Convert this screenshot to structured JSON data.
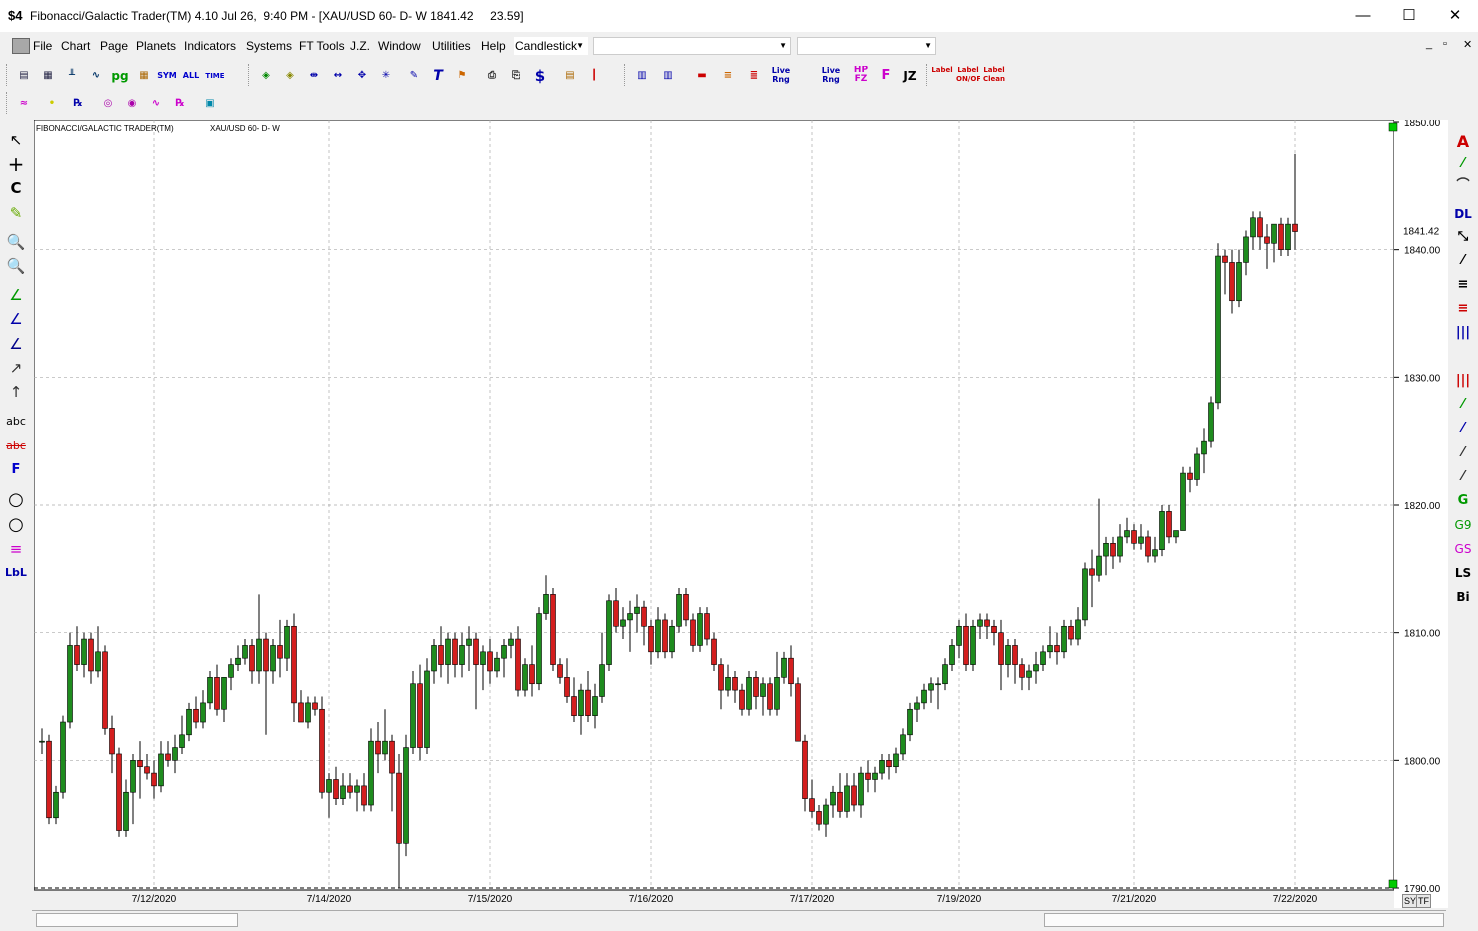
{
  "window": {
    "app_icon": "$4",
    "title": "Fibonacci/Galactic Trader(TM) 4.10 Jul 26,  9:40 PM - [XAU/USD 60- D- W 1841.42     23.59]",
    "minimize": "—",
    "maximize": "☐",
    "close": "✕"
  },
  "menu": {
    "items": [
      "File",
      "Chart",
      "Page",
      "Planets",
      "Indicators",
      "Systems",
      "FT Tools",
      "J.Z.",
      "Window",
      "Utilities",
      "Help"
    ],
    "chart_type": "Candlestick",
    "combo2": "",
    "combo3": "",
    "mdi_controls": [
      "_",
      "▫",
      "✕"
    ]
  },
  "toolbar1": [
    "pg",
    "SYM",
    "ALL",
    "TIME",
    "Live Rng",
    "Live Rng",
    "HP FZ",
    "JZ",
    "Label",
    "Label ON/OFF",
    "Label Clean"
  ],
  "left_tools": [
    "↖",
    "+",
    "C",
    "✎",
    "🔍",
    "🔍",
    "∠",
    "∠",
    "∠",
    "↗",
    "abc",
    "abc",
    "F",
    "○",
    "○",
    "≡",
    "LbL"
  ],
  "right_tools": [
    "A",
    "⁄",
    "⌒",
    "DL",
    "⤡",
    "⁄",
    "≡",
    "≡",
    "|||",
    "|||",
    "⁄",
    "⁄",
    "⁄",
    "⁄",
    "G",
    "G9",
    "GS",
    "LS",
    "Bi"
  ],
  "scroll": {
    "sy": "SY",
    "tf": "TF"
  },
  "chart_data": {
    "type": "candlestick",
    "title": "FIBONACCI/GALACTIC TRADER(TM)",
    "symbol": "XAU/USD 60- D- W",
    "last_price_label": "1841.42",
    "y_ticks": [
      "1850.00",
      "1840.00",
      "1830.00",
      "1820.00",
      "1810.00",
      "1800.00",
      "1790.00"
    ],
    "ylim": [
      1790,
      1850
    ],
    "x_ticks": [
      "7/12/2020",
      "7/14/2020",
      "7/15/2020",
      "7/16/2020",
      "7/17/2020",
      "7/19/2020",
      "7/21/2020",
      "7/22/2020"
    ],
    "x_tick_bar_index": [
      16,
      41,
      64,
      87,
      110,
      131,
      156,
      179
    ],
    "grid": true,
    "candles": [
      [
        1801.5,
        1802.5,
        1800.5,
        1801.5
      ],
      [
        1801.5,
        1802.0,
        1795.0,
        1795.5
      ],
      [
        1795.5,
        1798.0,
        1795.0,
        1797.5
      ],
      [
        1797.5,
        1803.5,
        1797.0,
        1803.0
      ],
      [
        1803.0,
        1810.0,
        1802.5,
        1809.0
      ],
      [
        1809.0,
        1810.5,
        1807.0,
        1807.5
      ],
      [
        1807.5,
        1810.0,
        1806.5,
        1809.5
      ],
      [
        1809.5,
        1810.0,
        1806.0,
        1807.0
      ],
      [
        1807.0,
        1810.5,
        1806.5,
        1808.5
      ],
      [
        1808.5,
        1809.0,
        1802.0,
        1802.5
      ],
      [
        1802.5,
        1803.5,
        1799.0,
        1800.5
      ],
      [
        1800.5,
        1801.0,
        1794.0,
        1794.5
      ],
      [
        1794.5,
        1798.5,
        1794.0,
        1797.5
      ],
      [
        1797.5,
        1800.5,
        1795.0,
        1800.0
      ],
      [
        1800.0,
        1801.5,
        1797.0,
        1799.5
      ],
      [
        1799.5,
        1800.5,
        1798.5,
        1799.0
      ],
      [
        1799.0,
        1800.0,
        1797.0,
        1798.0
      ],
      [
        1798.0,
        1801.5,
        1797.5,
        1800.5
      ],
      [
        1800.5,
        1801.5,
        1799.5,
        1800.0
      ],
      [
        1800.0,
        1802.0,
        1799.0,
        1801.0
      ],
      [
        1801.0,
        1803.5,
        1800.5,
        1802.0
      ],
      [
        1802.0,
        1804.5,
        1801.5,
        1804.0
      ],
      [
        1804.0,
        1805.0,
        1802.5,
        1803.0
      ],
      [
        1803.0,
        1805.5,
        1802.5,
        1804.5
      ],
      [
        1804.5,
        1807.0,
        1804.0,
        1806.5
      ],
      [
        1806.5,
        1807.5,
        1803.5,
        1804.0
      ],
      [
        1804.0,
        1806.5,
        1803.0,
        1806.5
      ],
      [
        1806.5,
        1808.0,
        1805.5,
        1807.5
      ],
      [
        1807.5,
        1809.0,
        1807.0,
        1808.0
      ],
      [
        1808.0,
        1809.5,
        1807.5,
        1809.0
      ],
      [
        1809.0,
        1809.5,
        1806.0,
        1807.0
      ],
      [
        1807.0,
        1813.0,
        1806.0,
        1809.5
      ],
      [
        1809.5,
        1810.0,
        1802.0,
        1807.0
      ],
      [
        1807.0,
        1809.5,
        1806.0,
        1809.0
      ],
      [
        1809.0,
        1811.0,
        1806.5,
        1808.0
      ],
      [
        1808.0,
        1811.0,
        1807.0,
        1810.5
      ],
      [
        1810.5,
        1811.5,
        1803.0,
        1804.5
      ],
      [
        1804.5,
        1805.5,
        1803.0,
        1803.0
      ],
      [
        1803.0,
        1805.0,
        1802.5,
        1804.5
      ],
      [
        1804.5,
        1805.0,
        1803.5,
        1804.0
      ],
      [
        1804.0,
        1805.0,
        1797.0,
        1797.5
      ],
      [
        1797.5,
        1799.0,
        1795.5,
        1798.5
      ],
      [
        1798.5,
        1799.5,
        1796.5,
        1797.0
      ],
      [
        1797.0,
        1799.0,
        1796.5,
        1798.0
      ],
      [
        1798.0,
        1799.0,
        1797.0,
        1797.5
      ],
      [
        1797.5,
        1798.5,
        1796.0,
        1798.0
      ],
      [
        1798.0,
        1799.0,
        1796.0,
        1796.5
      ],
      [
        1796.5,
        1802.5,
        1796.0,
        1801.5
      ],
      [
        1801.5,
        1803.0,
        1799.0,
        1800.5
      ],
      [
        1800.5,
        1804.0,
        1800.0,
        1801.5
      ],
      [
        1801.5,
        1802.0,
        1796.0,
        1799.0
      ],
      [
        1799.0,
        1800.5,
        1790.0,
        1793.5
      ],
      [
        1793.5,
        1802.0,
        1792.5,
        1801.0
      ],
      [
        1801.0,
        1807.0,
        1800.5,
        1806.0
      ],
      [
        1806.0,
        1807.5,
        1800.0,
        1801.0
      ],
      [
        1801.0,
        1808.0,
        1800.5,
        1807.0
      ],
      [
        1807.0,
        1809.5,
        1806.0,
        1809.0
      ],
      [
        1809.0,
        1810.5,
        1806.5,
        1807.5
      ],
      [
        1807.5,
        1810.0,
        1806.0,
        1809.5
      ],
      [
        1809.5,
        1810.0,
        1806.5,
        1807.5
      ],
      [
        1807.5,
        1810.0,
        1806.5,
        1809.0
      ],
      [
        1809.0,
        1810.5,
        1807.0,
        1809.5
      ],
      [
        1809.5,
        1810.0,
        1804.0,
        1807.5
      ],
      [
        1807.5,
        1809.0,
        1805.5,
        1808.5
      ],
      [
        1808.5,
        1809.5,
        1806.0,
        1807.0
      ],
      [
        1807.0,
        1808.5,
        1806.5,
        1808.0
      ],
      [
        1808.0,
        1809.5,
        1806.5,
        1809.0
      ],
      [
        1809.0,
        1810.0,
        1808.0,
        1809.5
      ],
      [
        1809.5,
        1810.5,
        1805.0,
        1805.5
      ],
      [
        1805.5,
        1808.0,
        1805.0,
        1807.5
      ],
      [
        1807.5,
        1809.0,
        1805.0,
        1806.0
      ],
      [
        1806.0,
        1812.0,
        1805.5,
        1811.5
      ],
      [
        1811.5,
        1814.5,
        1811.0,
        1813.0
      ],
      [
        1813.0,
        1813.5,
        1807.0,
        1807.5
      ],
      [
        1807.5,
        1808.0,
        1806.0,
        1806.5
      ],
      [
        1806.5,
        1808.0,
        1804.5,
        1805.0
      ],
      [
        1805.0,
        1806.5,
        1803.0,
        1803.5
      ],
      [
        1803.5,
        1806.0,
        1802.0,
        1805.5
      ],
      [
        1805.5,
        1807.0,
        1803.0,
        1803.5
      ],
      [
        1803.5,
        1806.0,
        1802.5,
        1805.0
      ],
      [
        1805.0,
        1810.0,
        1804.5,
        1807.5
      ],
      [
        1807.5,
        1813.0,
        1807.0,
        1812.5
      ],
      [
        1812.5,
        1813.5,
        1810.0,
        1810.5
      ],
      [
        1810.5,
        1812.0,
        1809.5,
        1811.0
      ],
      [
        1811.0,
        1812.5,
        1808.5,
        1811.5
      ],
      [
        1811.5,
        1813.0,
        1810.0,
        1812.0
      ],
      [
        1812.0,
        1812.5,
        1809.0,
        1810.5
      ],
      [
        1810.5,
        1811.0,
        1807.5,
        1808.5
      ],
      [
        1808.5,
        1812.0,
        1808.0,
        1811.0
      ],
      [
        1811.0,
        1811.5,
        1808.0,
        1808.5
      ],
      [
        1808.5,
        1811.0,
        1808.0,
        1810.5
      ],
      [
        1810.5,
        1813.5,
        1810.0,
        1813.0
      ],
      [
        1813.0,
        1813.5,
        1810.5,
        1811.0
      ],
      [
        1811.0,
        1811.5,
        1808.5,
        1809.0
      ],
      [
        1809.0,
        1812.0,
        1808.5,
        1811.5
      ],
      [
        1811.5,
        1812.0,
        1809.0,
        1809.5
      ],
      [
        1809.5,
        1810.0,
        1807.0,
        1807.5
      ],
      [
        1807.5,
        1808.0,
        1804.0,
        1805.5
      ],
      [
        1805.5,
        1807.5,
        1805.0,
        1806.5
      ],
      [
        1806.5,
        1807.0,
        1804.5,
        1805.5
      ],
      [
        1805.5,
        1806.0,
        1803.5,
        1804.0
      ],
      [
        1804.0,
        1807.0,
        1803.5,
        1806.5
      ],
      [
        1806.5,
        1807.0,
        1804.0,
        1805.0
      ],
      [
        1805.0,
        1806.5,
        1803.5,
        1806.0
      ],
      [
        1806.0,
        1806.5,
        1803.5,
        1804.0
      ],
      [
        1804.0,
        1808.5,
        1803.5,
        1806.5
      ],
      [
        1806.5,
        1808.5,
        1806.0,
        1808.0
      ],
      [
        1808.0,
        1809.0,
        1805.0,
        1806.0
      ],
      [
        1806.0,
        1806.5,
        1801.5,
        1801.5
      ],
      [
        1801.5,
        1802.0,
        1796.0,
        1797.0
      ],
      [
        1797.0,
        1798.5,
        1795.5,
        1796.0
      ],
      [
        1796.0,
        1796.5,
        1794.5,
        1795.0
      ],
      [
        1795.0,
        1797.0,
        1794.0,
        1796.5
      ],
      [
        1796.5,
        1798.0,
        1795.5,
        1797.5
      ],
      [
        1797.5,
        1799.0,
        1795.5,
        1796.0
      ],
      [
        1796.0,
        1799.0,
        1795.5,
        1798.0
      ],
      [
        1798.0,
        1799.0,
        1796.0,
        1796.5
      ],
      [
        1796.5,
        1799.5,
        1795.5,
        1799.0
      ],
      [
        1799.0,
        1800.0,
        1797.5,
        1798.5
      ],
      [
        1798.5,
        1799.5,
        1797.5,
        1799.0
      ],
      [
        1799.0,
        1800.5,
        1798.5,
        1800.0
      ],
      [
        1800.0,
        1800.5,
        1798.5,
        1799.5
      ],
      [
        1799.5,
        1801.0,
        1799.0,
        1800.5
      ],
      [
        1800.5,
        1802.5,
        1800.0,
        1802.0
      ],
      [
        1802.0,
        1804.5,
        1801.5,
        1804.0
      ],
      [
        1804.0,
        1805.0,
        1803.0,
        1804.5
      ],
      [
        1804.5,
        1806.0,
        1804.0,
        1805.5
      ],
      [
        1805.5,
        1806.5,
        1804.5,
        1806.0
      ],
      [
        1806.0,
        1806.5,
        1804.0,
        1806.0
      ],
      [
        1806.0,
        1808.0,
        1805.5,
        1807.5
      ],
      [
        1807.5,
        1809.5,
        1807.0,
        1809.0
      ],
      [
        1809.0,
        1811.0,
        1808.0,
        1810.5
      ],
      [
        1810.5,
        1811.5,
        1807.0,
        1807.5
      ],
      [
        1807.5,
        1811.0,
        1807.0,
        1810.5
      ],
      [
        1810.5,
        1811.5,
        1809.5,
        1811.0
      ],
      [
        1811.0,
        1811.5,
        1809.5,
        1810.5
      ],
      [
        1810.5,
        1811.0,
        1809.0,
        1810.0
      ],
      [
        1810.0,
        1811.0,
        1805.5,
        1807.5
      ],
      [
        1807.5,
        1809.5,
        1806.5,
        1809.0
      ],
      [
        1809.0,
        1809.5,
        1806.0,
        1807.5
      ],
      [
        1807.5,
        1808.0,
        1805.5,
        1806.5
      ],
      [
        1806.5,
        1807.5,
        1805.5,
        1807.0
      ],
      [
        1807.0,
        1808.5,
        1806.0,
        1807.5
      ],
      [
        1807.5,
        1809.0,
        1807.0,
        1808.5
      ],
      [
        1808.5,
        1810.5,
        1808.0,
        1809.0
      ],
      [
        1809.0,
        1810.0,
        1807.5,
        1808.5
      ],
      [
        1808.5,
        1811.0,
        1808.0,
        1810.5
      ],
      [
        1810.5,
        1811.0,
        1809.0,
        1809.5
      ],
      [
        1809.5,
        1812.0,
        1809.0,
        1811.0
      ],
      [
        1811.0,
        1815.5,
        1810.5,
        1815.0
      ],
      [
        1815.0,
        1816.5,
        1812.0,
        1814.5
      ],
      [
        1814.5,
        1820.5,
        1814.0,
        1816.0
      ],
      [
        1816.0,
        1817.5,
        1814.5,
        1817.0
      ],
      [
        1817.0,
        1817.5,
        1815.0,
        1816.0
      ],
      [
        1816.0,
        1818.5,
        1815.5,
        1817.5
      ],
      [
        1817.5,
        1819.0,
        1817.0,
        1818.0
      ],
      [
        1818.0,
        1818.5,
        1816.5,
        1817.0
      ],
      [
        1817.0,
        1818.5,
        1816.5,
        1817.5
      ],
      [
        1817.5,
        1818.0,
        1815.5,
        1816.0
      ],
      [
        1816.0,
        1817.5,
        1815.5,
        1816.5
      ],
      [
        1816.5,
        1820.0,
        1816.0,
        1819.5
      ],
      [
        1819.5,
        1820.0,
        1817.0,
        1817.5
      ],
      [
        1817.5,
        1818.0,
        1817.0,
        1818.0
      ],
      [
        1818.0,
        1823.0,
        1818.0,
        1822.5
      ],
      [
        1822.5,
        1823.0,
        1821.0,
        1822.0
      ],
      [
        1822.0,
        1824.5,
        1821.5,
        1824.0
      ],
      [
        1824.0,
        1826.0,
        1822.5,
        1825.0
      ],
      [
        1825.0,
        1828.5,
        1824.5,
        1828.0
      ],
      [
        1828.0,
        1840.5,
        1827.5,
        1839.5
      ],
      [
        1839.5,
        1840.0,
        1836.5,
        1839.0
      ],
      [
        1839.0,
        1840.0,
        1835.0,
        1836.0
      ],
      [
        1836.0,
        1840.0,
        1835.5,
        1839.0
      ],
      [
        1839.0,
        1841.5,
        1838.0,
        1841.0
      ],
      [
        1841.0,
        1843.0,
        1840.0,
        1842.5
      ],
      [
        1842.5,
        1843.0,
        1840.0,
        1841.0
      ],
      [
        1841.0,
        1842.0,
        1838.5,
        1840.5
      ],
      [
        1840.5,
        1842.0,
        1839.0,
        1842.0
      ],
      [
        1842.0,
        1842.5,
        1839.5,
        1840.0
      ],
      [
        1840.0,
        1842.5,
        1839.5,
        1842.0
      ],
      [
        1842.0,
        1847.5,
        1840.0,
        1841.42
      ]
    ]
  }
}
